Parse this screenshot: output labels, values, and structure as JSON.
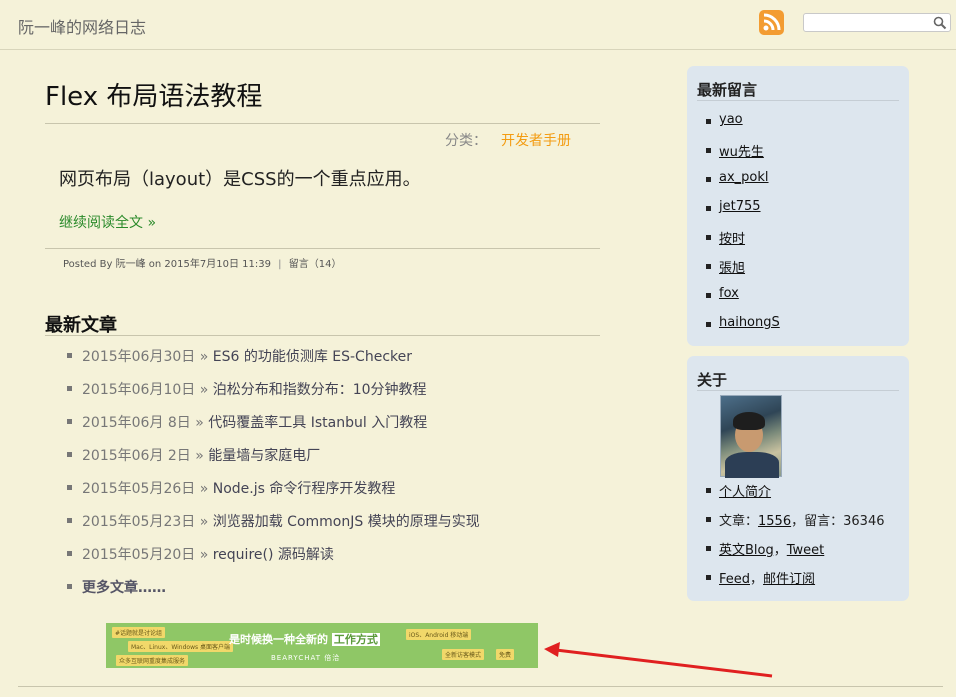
{
  "header": {
    "site_title": "阮一峰的网络日志",
    "rss_icon": "rss-icon",
    "search_placeholder": "",
    "search_icon": "search-icon"
  },
  "article": {
    "title": "Flex 布局语法教程",
    "category_label": "分类：",
    "category_value": "开发者手册",
    "summary": "网页布局（layout）是CSS的一个重点应用。",
    "read_more": "继续阅读全文 »",
    "meta": {
      "posted_by": "Posted By",
      "author": "阮一峰",
      "on": "on",
      "date": "2015年7月10日 11:39",
      "separator": "|",
      "comments": "留言（14）"
    }
  },
  "recent": {
    "title": "最新文章",
    "items": [
      {
        "date": "2015年06月30日 »",
        "title": "ES6 的功能侦测库 ES-Checker"
      },
      {
        "date": "2015年06月10日 »",
        "title": "泊松分布和指数分布：10分钟教程"
      },
      {
        "date": "2015年06月 8日 »",
        "title": "代码覆盖率工具 Istanbul 入门教程"
      },
      {
        "date": "2015年06月 2日 »",
        "title": "能量墙与家庭电厂"
      },
      {
        "date": "2015年05月26日 »",
        "title": "Node.js 命令行程序开发教程"
      },
      {
        "date": "2015年05月23日 »",
        "title": "浏览器加载 CommonJS 模块的原理与实现"
      },
      {
        "date": "2015年05月20日 »",
        "title": "require() 源码解读"
      }
    ],
    "more": "更多文章……"
  },
  "ad": {
    "headline_prefix": "是时候换一种全新的",
    "headline_highlight": "工作方式",
    "brand": "BEARYCHAT 倍洽",
    "tags": [
      "#话题就是讨论组",
      "Mac、Linux、Windows 桌面客户端",
      "众多互联网重度集成服务",
      "iOS、Android 移动端",
      "全新访客模式",
      "免费"
    ],
    "background": "#8fc766"
  },
  "sidebar": {
    "comments": {
      "title": "最新留言",
      "items": [
        "yao",
        "wu先生",
        "ax_pokl",
        "jet755",
        "按时",
        "張旭",
        "fox",
        "haihongS"
      ]
    },
    "about": {
      "title": "关于",
      "profile_link": "个人简介",
      "stats_prefix": "文章：",
      "stats_articles": "1556",
      "stats_middle": "，留言：",
      "stats_comments": "36346",
      "blog_link": "英文Blog",
      "tweet_link": "Tweet",
      "comma": "，",
      "feed_link": "Feed",
      "mail_link": "邮件订阅"
    }
  },
  "colors": {
    "background": "#f5f2d9",
    "sidebar": "#dde6ee",
    "category_accent": "#f39c12",
    "read_more": "#2a8a2a",
    "arrow": "#e02020"
  }
}
